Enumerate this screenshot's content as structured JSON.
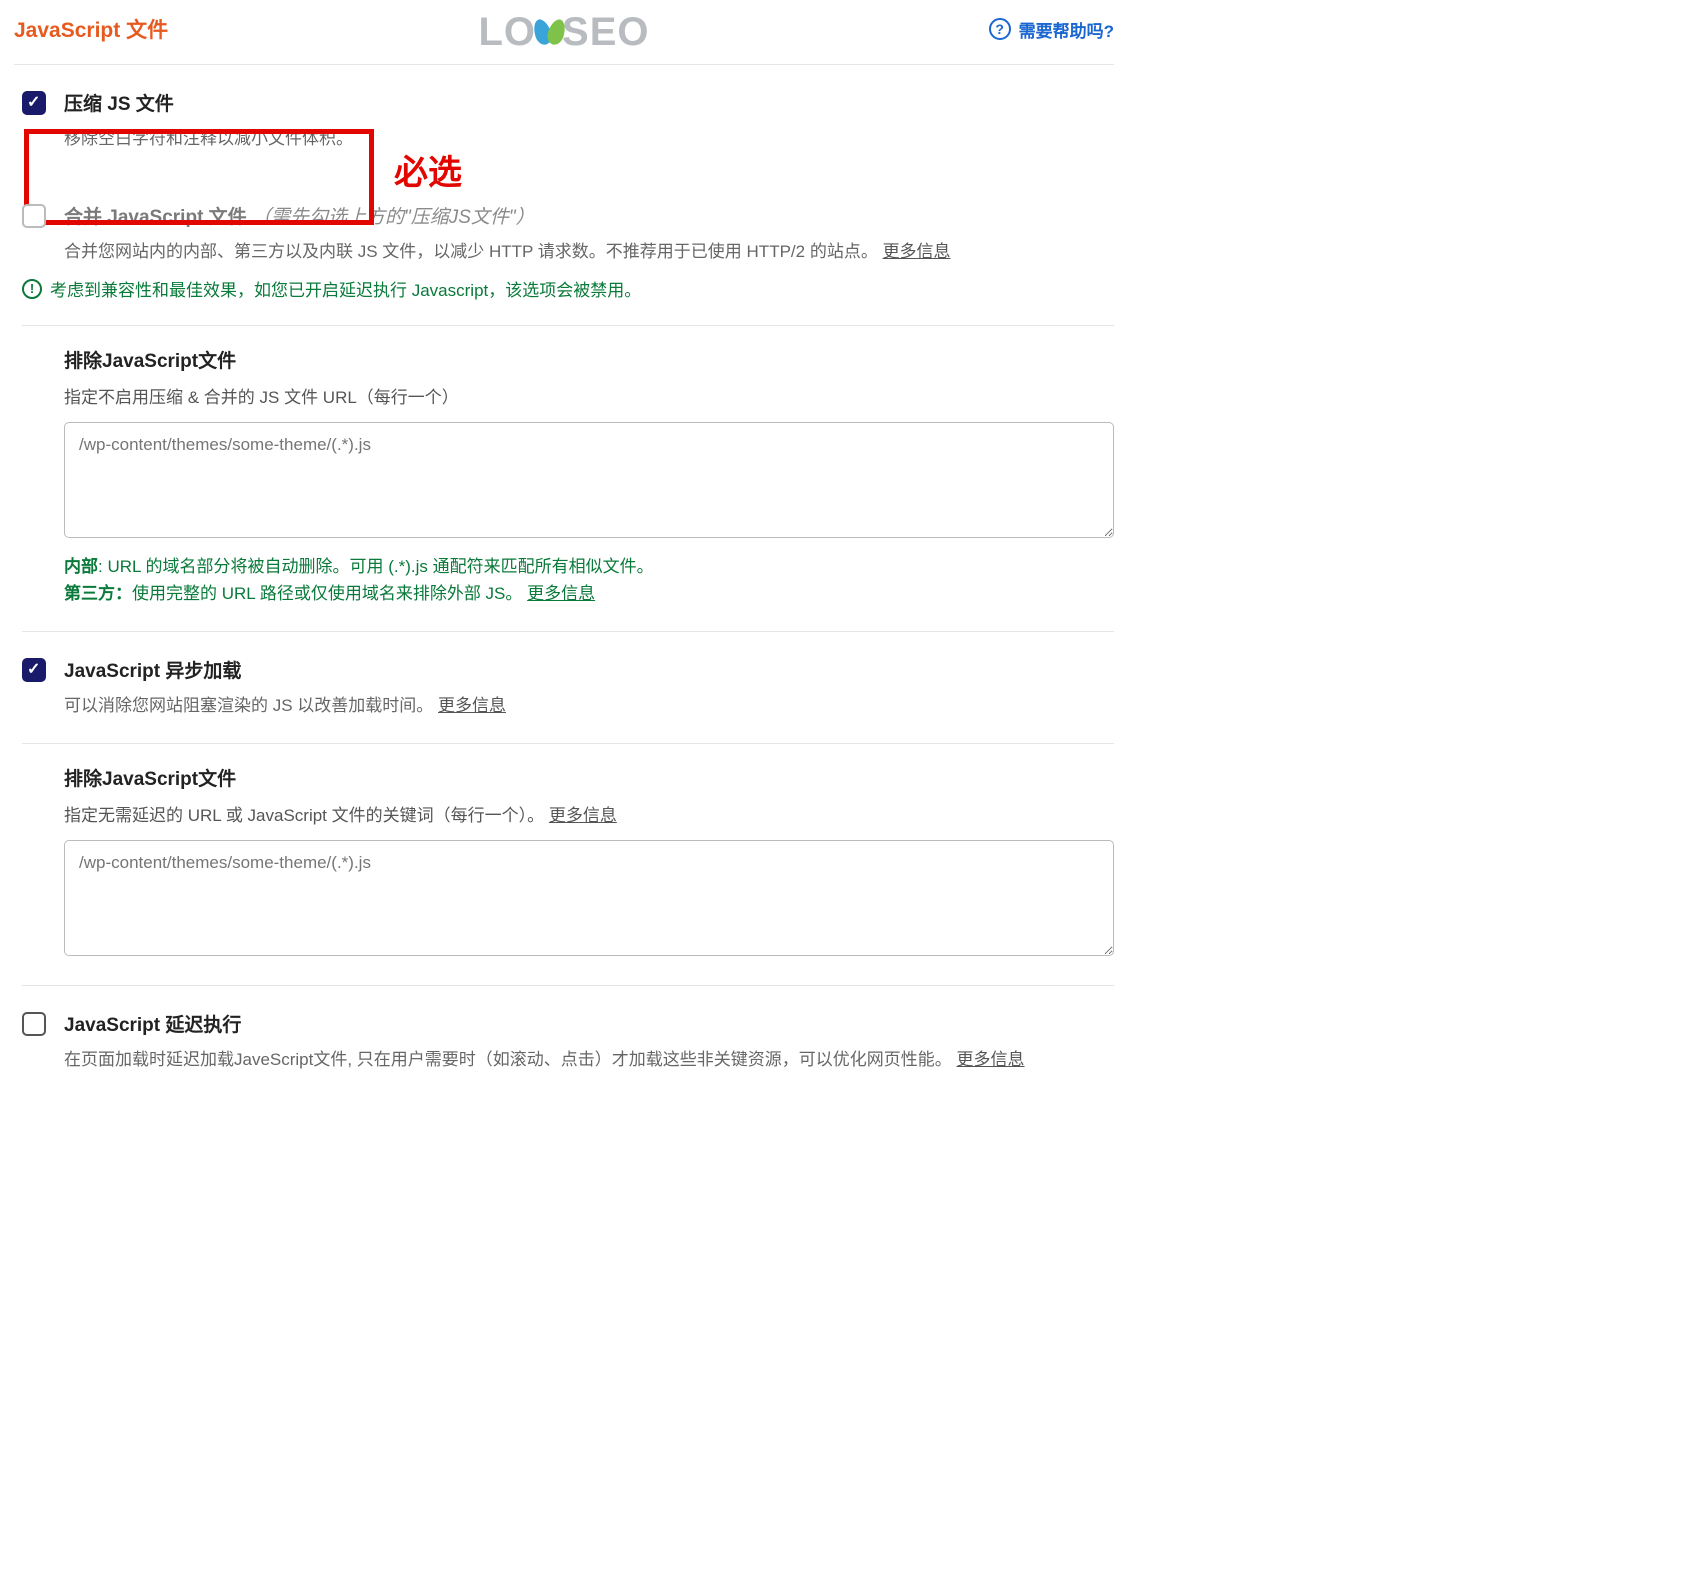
{
  "header": {
    "title": "JavaScript 文件",
    "logo_text_left": "LO",
    "logo_text_right": "SEO",
    "help_label": "需要帮助吗?",
    "help_glyph": "?"
  },
  "annotation": {
    "required_label": "必选"
  },
  "minify": {
    "title": "压缩 JS 文件",
    "desc": "移除空白字符和注释以减小文件体积。",
    "checked": true
  },
  "combine": {
    "title_main": "合并 JavaScript 文件",
    "title_paren": "（需先勾选上方的\"压缩JS文件\"）",
    "desc_before": "合并您网站内的内部、第三方以及内联 JS 文件，以减少 HTTP 请求数。不推荐用于已使用 HTTP/2 的站点。",
    "more": "更多信息",
    "checked": false,
    "warning": "考虑到兼容性和最佳效果，如您已开启延迟执行 Javascript，该选项会被禁用。",
    "warning_glyph": "!"
  },
  "exclude1": {
    "title": "排除JavaScript文件",
    "desc": "指定不启用压缩 & 合并的 JS 文件 URL（每行一个）",
    "placeholder": "/wp-content/themes/some-theme/(.*).js",
    "hint_internal_label": "内部",
    "hint_internal_text": ": URL 的域名部分将被自动删除。可用 (.*).js 通配符来匹配所有相似文件。",
    "hint_third_label": "第三方：",
    "hint_third_text": "使用完整的 URL 路径或仅使用域名来排除外部 JS。",
    "hint_more": "更多信息"
  },
  "defer": {
    "title": "JavaScript 异步加载",
    "desc_before": "可以消除您网站阻塞渲染的 JS 以改善加载时间。",
    "more": "更多信息",
    "checked": true
  },
  "exclude2": {
    "title": "排除JavaScript文件",
    "desc_before": "指定无需延迟的 URL 或 JavaScript 文件的关键词（每行一个）。",
    "more": "更多信息",
    "placeholder": "/wp-content/themes/some-theme/(.*).js"
  },
  "delay": {
    "title": "JavaScript 延迟执行",
    "desc_before": "在页面加载时延迟加载JaveScript文件, 只在用户需要时（如滚动、点击）才加载这些非关键资源，可以优化网页性能。",
    "more": "更多信息",
    "checked": false
  }
}
